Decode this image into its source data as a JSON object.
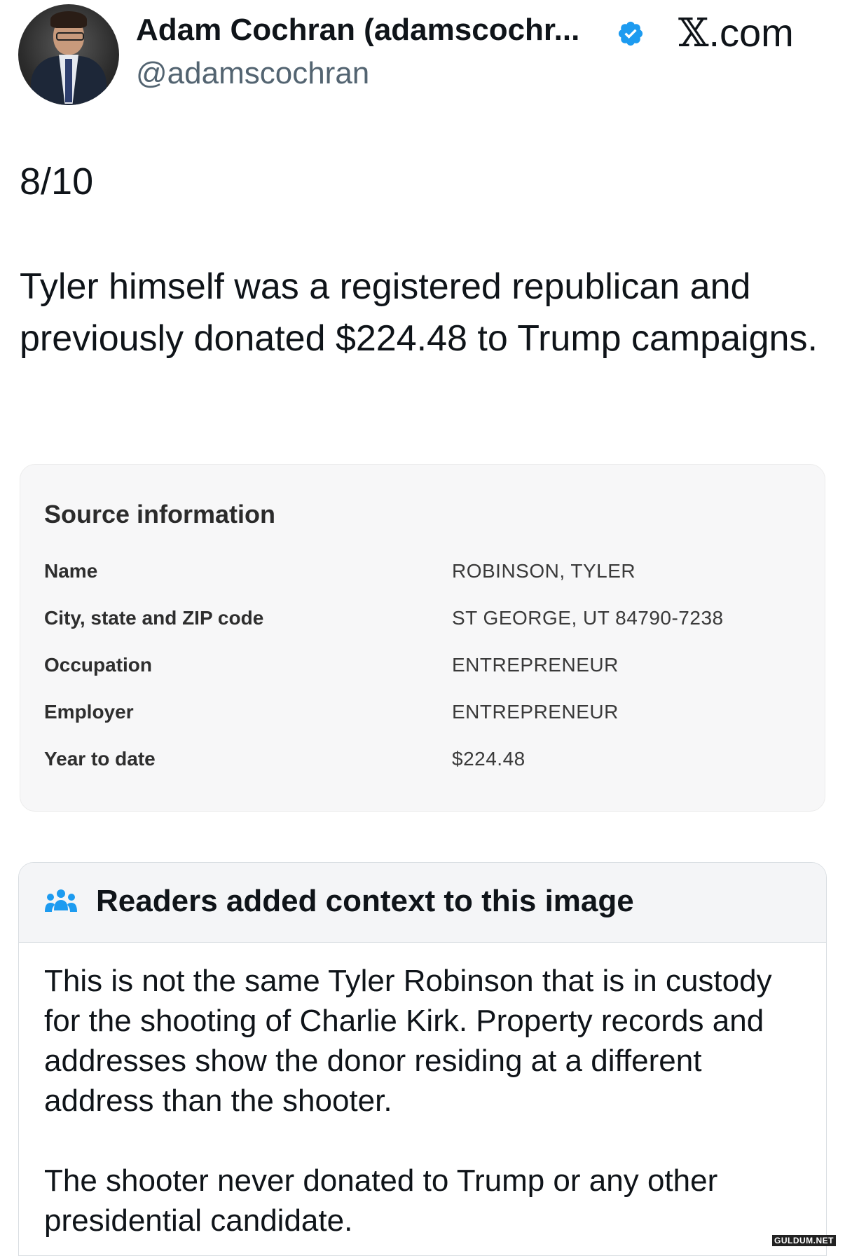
{
  "header": {
    "display_name": "Adam Cochran (adamscochr...",
    "handle": "@adamscochran",
    "site_label": ".com",
    "site_mark": "𝕏",
    "verified_color": "#1d9bf0"
  },
  "tweet": {
    "thread_number": "8/10",
    "text": "Tyler himself was a registered republican and previously donated $224.48 to Trump campaigns."
  },
  "source_card": {
    "title": "Source information",
    "rows": [
      {
        "label": "Name",
        "value": "ROBINSON, TYLER"
      },
      {
        "label": "City, state and ZIP code",
        "value": "ST GEORGE, UT 84790-7238"
      },
      {
        "label": "Occupation",
        "value": "ENTREPRENEUR"
      },
      {
        "label": "Employer",
        "value": "ENTREPRENEUR"
      },
      {
        "label": "Year to date",
        "value": "$224.48"
      }
    ]
  },
  "community_note": {
    "title": "Readers added context to this image",
    "icon_color": "#1d9bf0",
    "paragraphs": [
      "This is not the same Tyler Robinson that is in custody for the shooting of Charlie Kirk. Property records and addresses show the donor residing at a different address than the shooter.",
      "The shooter never donated to Trump or any other presidential candidate."
    ]
  },
  "watermark": "GULDUM.NET"
}
